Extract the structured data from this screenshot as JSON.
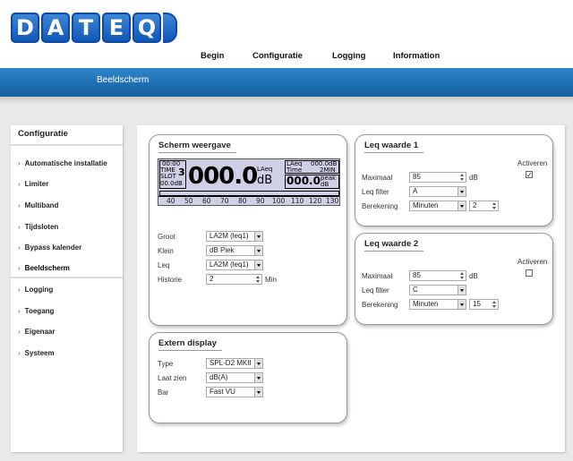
{
  "logo": {
    "letters": [
      "D",
      "A",
      "T",
      "E",
      "Q"
    ]
  },
  "topnav": {
    "items": [
      "Begin",
      "Configuratie",
      "Logging",
      "Information"
    ]
  },
  "page_heading": "Beeldscherm",
  "sidebar": {
    "title": "Configuratie",
    "items": [
      "Automatische installatie",
      "Limiter",
      "Multiband",
      "Tijdsloten",
      "Bypass kalender",
      "Beeldscherm",
      "Logging",
      "Toegang",
      "Eigenaar",
      "Systeem"
    ],
    "active": "Beeldscherm"
  },
  "scherm": {
    "title": "Scherm weergave",
    "lcd": {
      "time": "00:00",
      "time_label": "TIME",
      "slot_label": "SLOT",
      "slot_number": "3",
      "small_db": "00.0dB",
      "big_value": "000.0",
      "big_label": "LAeq",
      "big_unit": "dB",
      "leq_label": "LAeq",
      "leq_value": "000.0dB",
      "time2_label": "Time",
      "time2_value": "2MIN",
      "peak_value": "000.0",
      "peak_label": "peak",
      "peak_unit": "dB",
      "scale": [
        "40",
        "50",
        "60",
        "70",
        "80",
        "90",
        "100",
        "110",
        "120",
        "130"
      ]
    },
    "fields": {
      "groot": {
        "label": "Groot",
        "value": "LA2M (leq1)"
      },
      "klein": {
        "label": "Klein",
        "value": "dB Piek"
      },
      "leq": {
        "label": "Leq",
        "value": "LA2M (leq1)"
      },
      "historie": {
        "label": "Historie",
        "value": "2",
        "unit": "Min"
      }
    }
  },
  "extern": {
    "title": "Extern display",
    "fields": {
      "type": {
        "label": "Type",
        "value": "SPL-D2 MKII"
      },
      "laatzien": {
        "label": "Laat zien",
        "value": "dB(A)"
      },
      "bar": {
        "label": "Bar",
        "value": "Fast VU"
      }
    }
  },
  "leq1": {
    "title": "Leq waarde 1",
    "activeren_label": "Activeren",
    "activeren_checked": true,
    "check_mark": "✓",
    "maximaal": {
      "label": "Maximaal",
      "value": "85",
      "unit": "dB"
    },
    "filter": {
      "label": "Leq filter",
      "value": "A"
    },
    "berekening": {
      "label": "Berekening",
      "value": "Minuten",
      "number": "2"
    }
  },
  "leq2": {
    "title": "Leq waarde 2",
    "activeren_label": "Activeren",
    "activeren_checked": false,
    "maximaal": {
      "label": "Maximaal",
      "value": "85",
      "unit": "dB"
    },
    "filter": {
      "label": "Leq filter",
      "value": "C"
    },
    "berekening": {
      "label": "Berekening",
      "value": "Minuten",
      "number": "15"
    }
  },
  "colors": {
    "accent": "#1d6db1",
    "logo": "#1157b8",
    "lcd": "#cfcfe6"
  }
}
